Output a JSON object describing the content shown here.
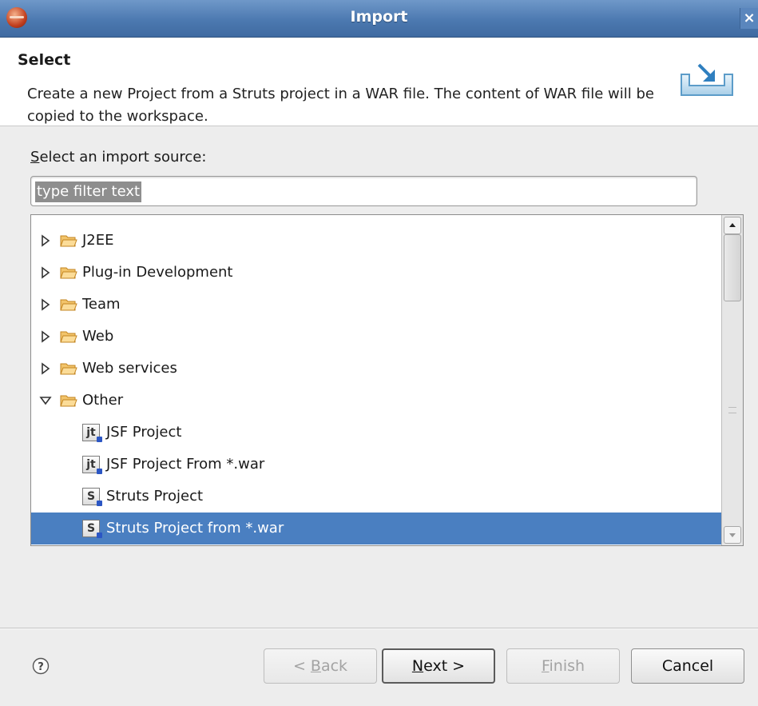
{
  "window": {
    "title": "Import",
    "close_glyph": "×",
    "app_icon": "eclipse-icon"
  },
  "banner": {
    "heading": "Select",
    "description": "Create a new Project from a Struts project in a WAR file. The content of WAR file will be copied to the workspace.",
    "icon": "import-wizard-icon"
  },
  "source": {
    "label_mnemonic": "S",
    "label_rest": "elect an import source:",
    "filter_placeholder": "type filter text",
    "filter_value": "type filter text"
  },
  "tree": {
    "items": [
      {
        "label": "J2EE",
        "kind": "folder",
        "expanded": false
      },
      {
        "label": "Plug-in Development",
        "kind": "folder",
        "expanded": false
      },
      {
        "label": "Team",
        "kind": "folder",
        "expanded": false
      },
      {
        "label": "Web",
        "kind": "folder",
        "expanded": false
      },
      {
        "label": "Web services",
        "kind": "folder",
        "expanded": false
      },
      {
        "label": "Other",
        "kind": "folder",
        "expanded": true
      },
      {
        "label": "JSF Project",
        "kind": "jsf",
        "icon_letter": "jt"
      },
      {
        "label": "JSF Project From *.war",
        "kind": "jsf",
        "icon_letter": "jt"
      },
      {
        "label": "Struts Project",
        "kind": "struts",
        "icon_letter": "S"
      },
      {
        "label": "Struts Project from *.war",
        "kind": "struts",
        "icon_letter": "S",
        "selected": true
      }
    ]
  },
  "footer": {
    "help_icon": "help-icon",
    "back": {
      "prefix": "< ",
      "mnemonic": "B",
      "rest": "ack",
      "enabled": false
    },
    "next": {
      "mnemonic": "N",
      "rest": "ext >",
      "enabled": true
    },
    "finish": {
      "mnemonic": "F",
      "rest": "inish",
      "enabled": false
    },
    "cancel": {
      "label": "Cancel",
      "enabled": true
    }
  },
  "colors": {
    "selection": "#4a7fc1",
    "titlebar": "#4c79b0",
    "folder": "#e8a33c"
  }
}
